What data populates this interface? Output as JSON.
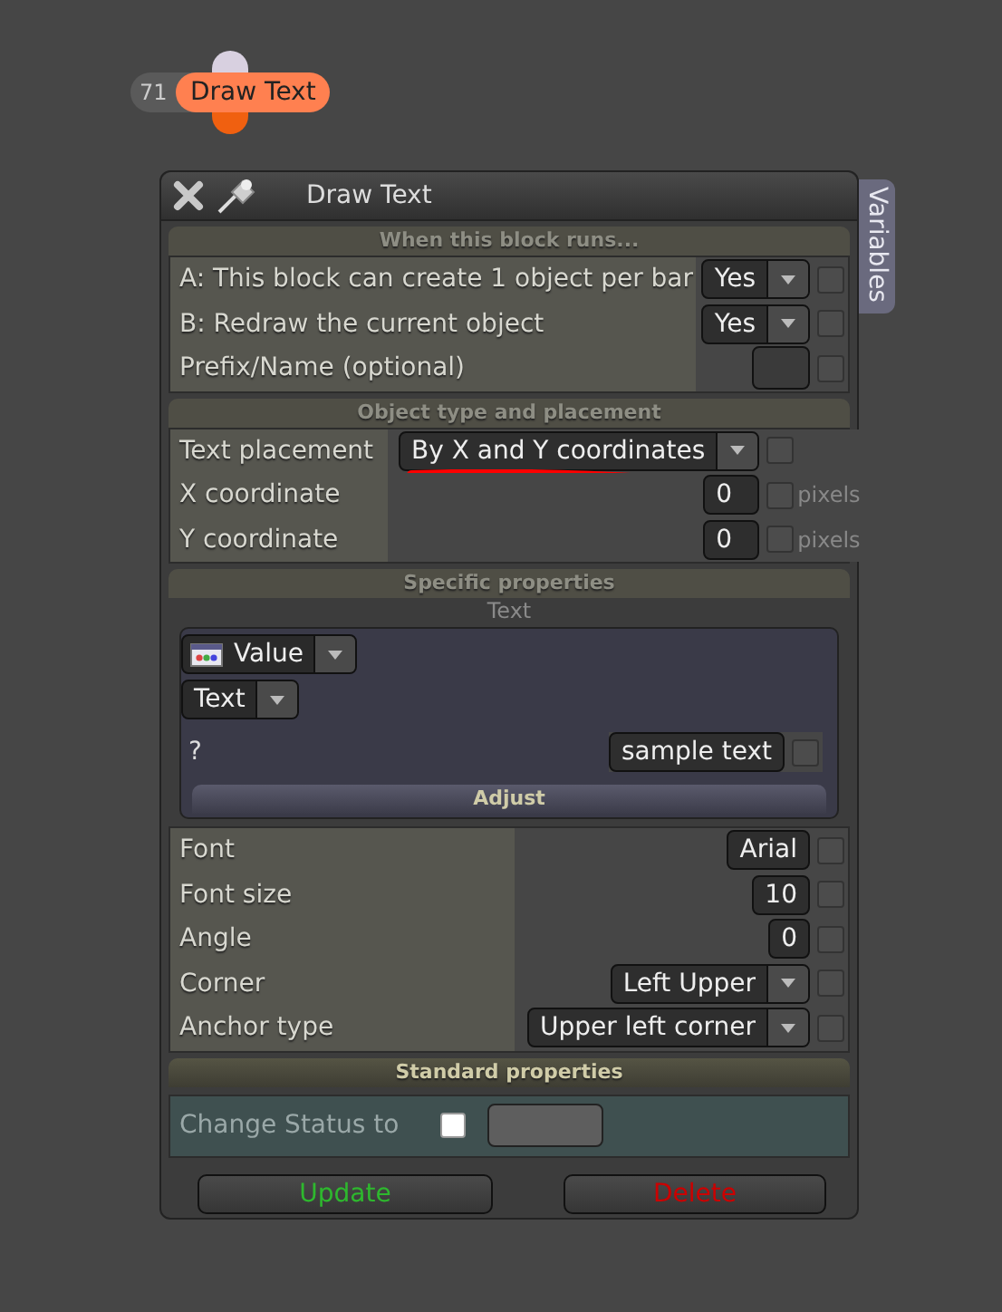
{
  "node": {
    "number": "71",
    "label": "Draw Text"
  },
  "window": {
    "title": "Draw Text",
    "side_tab": "Variables"
  },
  "sections": [
    {
      "kind": "general",
      "title": "When this block runs...",
      "rows": [
        {
          "kind": "dropdown",
          "label": "A: This block can create 1 object per bar",
          "value": "Yes",
          "checked": false
        },
        {
          "kind": "dropdown",
          "label": "B: Redraw the current object",
          "value": "Yes",
          "checked": false
        },
        {
          "kind": "input",
          "label": "Prefix/Name (optional)",
          "checked": false
        }
      ]
    },
    {
      "kind": "placement",
      "title": "Object type and placement",
      "rows": [
        {
          "kind": "dropdown",
          "label": "Text placement",
          "value": "By X and Y coordinates",
          "checked": false,
          "underlined": true
        },
        {
          "kind": "input",
          "label": "X coordinate",
          "value": "0",
          "checked": false,
          "unit": "pixels"
        },
        {
          "kind": "input",
          "label": "Y coordinate",
          "value": "0",
          "checked": false,
          "unit": "pixels"
        }
      ]
    },
    {
      "kind": "specific",
      "title": "Specific properties",
      "subtitle": "Text",
      "source": {
        "value": "Value",
        "type": "Text",
        "label": "?",
        "text": "sample text",
        "checked": false,
        "adjust": "Adjust"
      },
      "rows": [
        {
          "kind": "input",
          "label": "Font",
          "value": "Arial",
          "checked": false
        },
        {
          "kind": "input",
          "label": "Font size",
          "value": "10",
          "checked": false
        },
        {
          "kind": "input",
          "label": "Angle",
          "value": "0",
          "checked": false
        },
        {
          "kind": "dropdown",
          "label": "Corner",
          "value": "Left Upper",
          "checked": false
        },
        {
          "kind": "dropdown",
          "label": "Anchor type",
          "value": "Upper left corner",
          "checked": false
        }
      ]
    },
    {
      "kind": "standard",
      "title": "Standard properties",
      "status": {
        "label": "Change Status to",
        "checked": false
      }
    }
  ],
  "buttons": [
    {
      "kind": "update",
      "label": "Update"
    },
    {
      "kind": "delete",
      "label": "Delete"
    }
  ]
}
